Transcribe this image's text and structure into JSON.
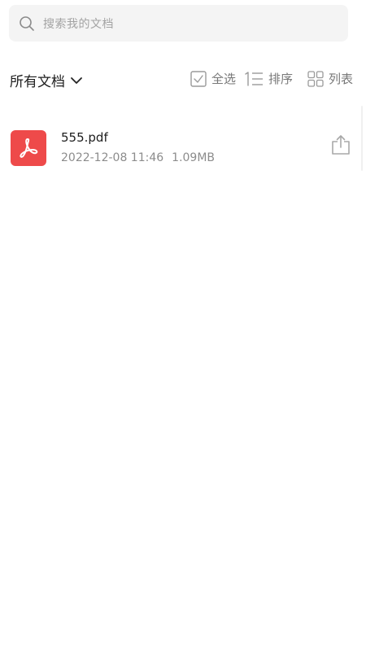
{
  "search": {
    "placeholder": "搜索我的文档",
    "icon": "search-icon"
  },
  "toolbar": {
    "filter_label": "所有文档",
    "select_all_label": "全选",
    "sort_label": "排序",
    "list_label": "列表"
  },
  "files": [
    {
      "name": "555.pdf",
      "date": "2022-12-08 11:46",
      "size": "1.09MB",
      "type_icon": "pdf-icon",
      "action_icon": "share-icon"
    }
  ],
  "colors": {
    "pdf_red": "#ee4a4a",
    "search_bg": "#f4f4f4",
    "muted_text": "#8c8c8c"
  }
}
